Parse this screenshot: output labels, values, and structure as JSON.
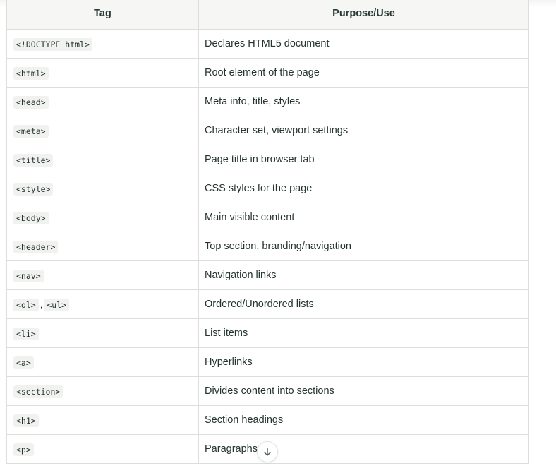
{
  "table": {
    "headers": [
      "Tag",
      "Purpose/Use"
    ],
    "rows": [
      {
        "tags": [
          "<!DOCTYPE html>"
        ],
        "use": "Declares HTML5 document"
      },
      {
        "tags": [
          "<html>"
        ],
        "use": "Root element of the page"
      },
      {
        "tags": [
          "<head>"
        ],
        "use": "Meta info, title, styles"
      },
      {
        "tags": [
          "<meta>"
        ],
        "use": "Character set, viewport settings"
      },
      {
        "tags": [
          "<title>"
        ],
        "use": "Page title in browser tab"
      },
      {
        "tags": [
          "<style>"
        ],
        "use": "CSS styles for the page"
      },
      {
        "tags": [
          "<body>"
        ],
        "use": "Main visible content"
      },
      {
        "tags": [
          "<header>"
        ],
        "use": "Top section, branding/navigation"
      },
      {
        "tags": [
          "<nav>"
        ],
        "use": "Navigation links"
      },
      {
        "tags": [
          "<ol>",
          "<ul>"
        ],
        "separator": ",",
        "use": "Ordered/Unordered lists"
      },
      {
        "tags": [
          "<li>"
        ],
        "use": "List items"
      },
      {
        "tags": [
          "<a>"
        ],
        "use": "Hyperlinks"
      },
      {
        "tags": [
          "<section>"
        ],
        "use": "Divides content into sections"
      },
      {
        "tags": [
          "<h1>"
        ],
        "use": "Section headings"
      },
      {
        "tags": [
          "<p>"
        ],
        "use": "Paragraphs"
      }
    ]
  },
  "scroll_button": {
    "icon": "arrow-down-icon"
  },
  "colors": {
    "accent": "#2f5a4f",
    "border": "#dcdedb",
    "header_bg": "#f6f6f4",
    "code_bg": "#f1f2f0"
  }
}
